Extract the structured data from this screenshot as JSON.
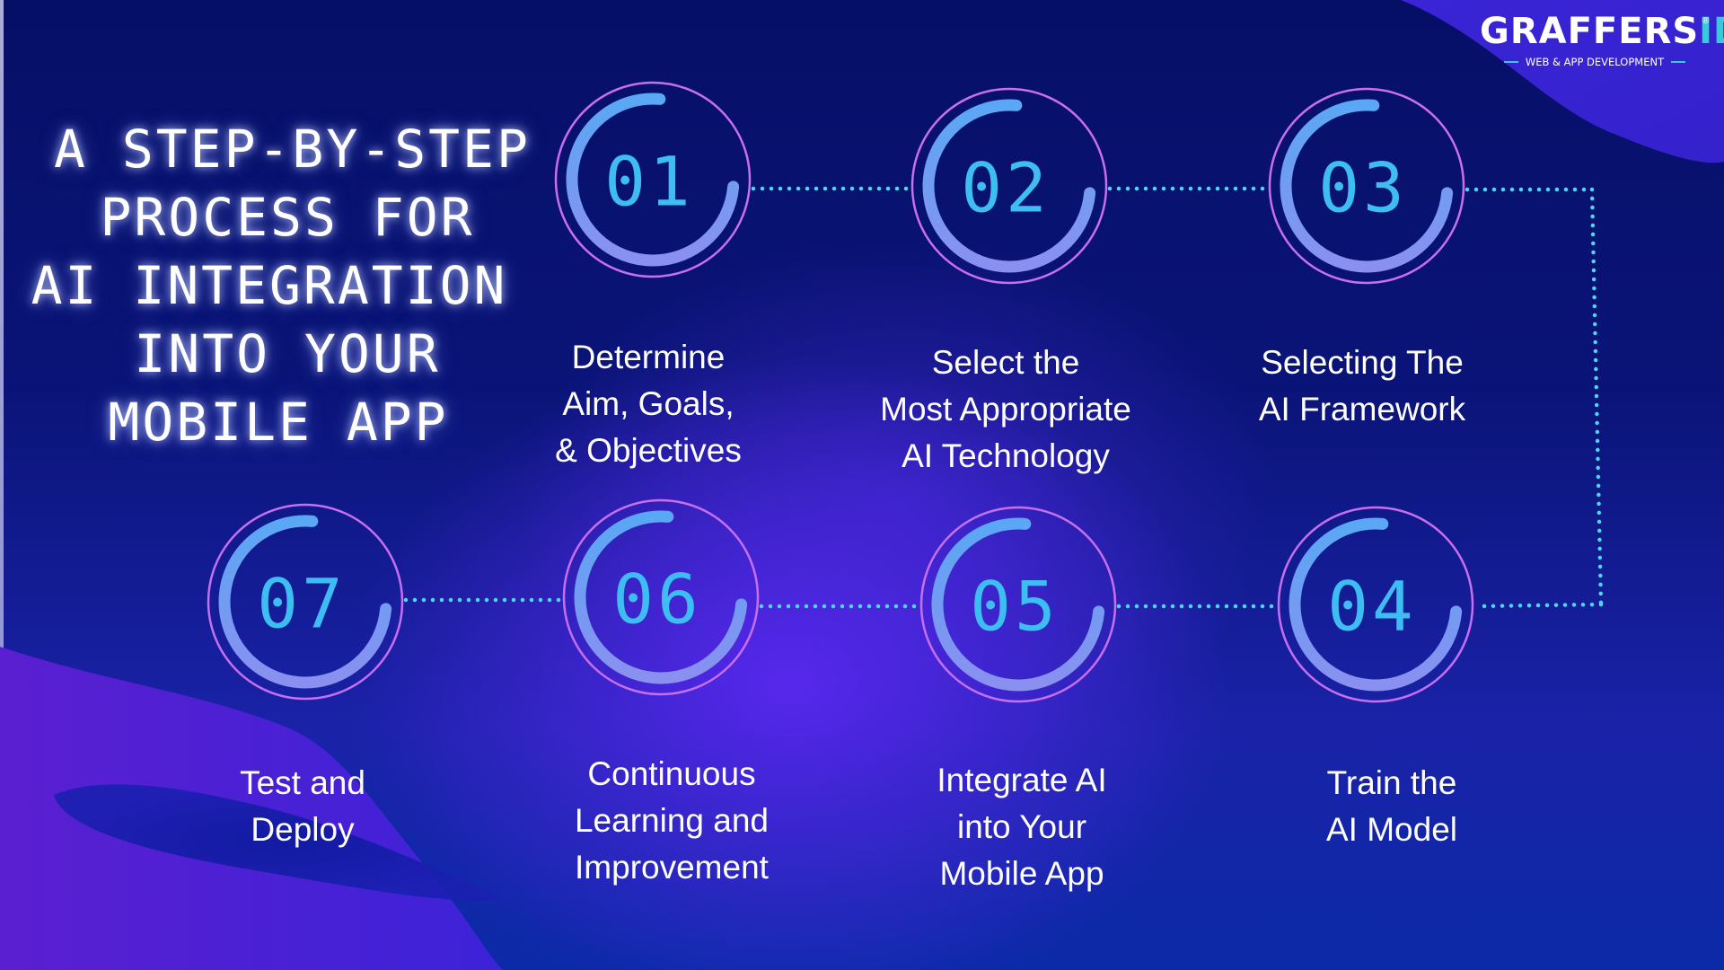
{
  "title": {
    "lines": [
      "A STEP-BY-STEP",
      "PROCESS FOR",
      "AI INTEGRATION",
      "INTO YOUR",
      "MOBILE APP"
    ]
  },
  "brand": {
    "name_main": "GRAFFERS",
    "name_accent": "ID",
    "registered": "®",
    "tagline": "WEB & APP DEVELOPMENT",
    "accent_color": "#3bc7dc"
  },
  "colors": {
    "ring": "#c86ef0",
    "arc_start": "#5aa8f5",
    "arc_end": "#8a90f0",
    "number": "#3dbdf2",
    "connector": "#4fd6f0"
  },
  "steps": [
    {
      "number": "01",
      "label_lines": [
        "Determine",
        "Aim, Goals,",
        "& Objectives"
      ]
    },
    {
      "number": "02",
      "label_lines": [
        "Select the",
        "Most Appropriate",
        "AI Technology"
      ]
    },
    {
      "number": "03",
      "label_lines": [
        "Selecting The",
        "AI Framework"
      ]
    },
    {
      "number": "04",
      "label_lines": [
        "Train the",
        "AI Model"
      ]
    },
    {
      "number": "05",
      "label_lines": [
        "Integrate AI",
        "into Your",
        "Mobile App"
      ]
    },
    {
      "number": "06",
      "label_lines": [
        "Continuous",
        "Learning and",
        "Improvement"
      ]
    },
    {
      "number": "07",
      "label_lines": [
        "Test and",
        "Deploy"
      ]
    }
  ]
}
